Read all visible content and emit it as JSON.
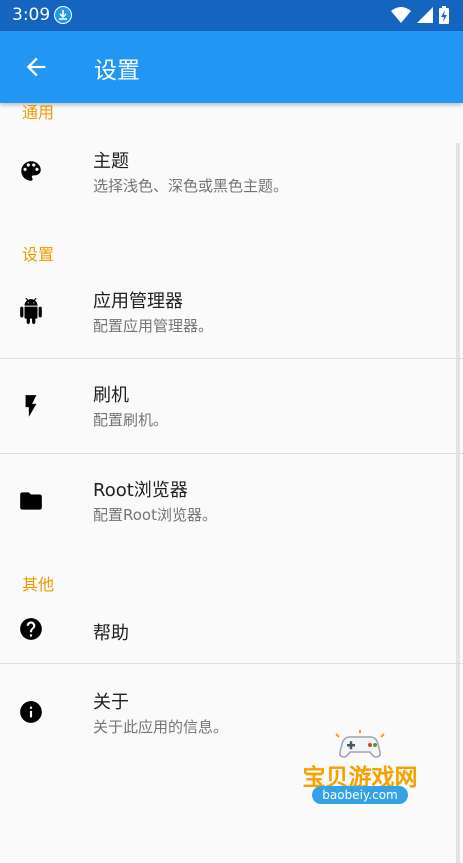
{
  "status_bar": {
    "time": "3:09"
  },
  "app_bar": {
    "title": "设置"
  },
  "sections": {
    "general": {
      "header": "通用",
      "items": [
        {
          "title": "主题",
          "summary": "选择浅色、深色或黑色主题。",
          "icon": "palette-icon"
        }
      ]
    },
    "settings": {
      "header": "设置",
      "items": [
        {
          "title": "应用管理器",
          "summary": "配置应用管理器。",
          "icon": "android-icon"
        },
        {
          "title": "刷机",
          "summary": "配置刷机。",
          "icon": "flash-icon"
        },
        {
          "title": "Root浏览器",
          "summary": "配置Root浏览器。",
          "icon": "folder-icon"
        }
      ]
    },
    "other": {
      "header": "其他",
      "items": [
        {
          "title": "帮助",
          "summary": "",
          "icon": "help-icon"
        },
        {
          "title": "关于",
          "summary": "关于此应用的信息。",
          "icon": "info-icon"
        }
      ]
    }
  },
  "watermark": {
    "title": "宝贝游戏网",
    "url": "baobeiy.com"
  },
  "colors": {
    "status_bar": "#1565c0",
    "app_bar": "#2196f3",
    "section_header": "#f29900",
    "background": "#fafafa"
  }
}
